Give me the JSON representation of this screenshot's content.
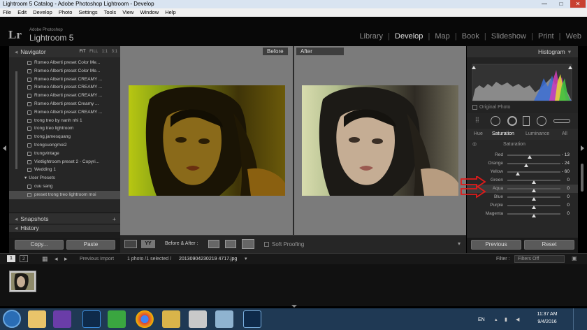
{
  "window": {
    "title": "Lightroom 5 Catalog - Adobe Photoshop Lightroom - Develop",
    "minimize": "—",
    "maximize": "□",
    "close": "✕"
  },
  "menu": [
    "File",
    "Edit",
    "Develop",
    "Photo",
    "Settings",
    "Tools",
    "View",
    "Window",
    "Help"
  ],
  "identity": {
    "logo": "Lr",
    "brand_small": "Adobe Photoshop",
    "brand": "Lightroom 5"
  },
  "modules": {
    "library": "Library",
    "develop": "Develop",
    "map": "Map",
    "book": "Book",
    "slideshow": "Slideshow",
    "print": "Print",
    "web": "Web",
    "sep": "|"
  },
  "left": {
    "navigator": "Navigator",
    "zoom": [
      "FIT",
      "FILL",
      "1:1",
      "3:1"
    ],
    "presets": [
      "Romeo Alberti preset Color Me...",
      "Romeo Alberti preset Color Me...",
      "Romeo Alberti preset CREAMY ...",
      "Romeo Alberti preset CREAMY ...",
      "Romeo Alberti preset CREAMY ...",
      "Romeo Alberti preset Creamy ...",
      "Romeo Alberti preset CREAMY ...",
      "trong treo by nanh nhi 1",
      "trong treo lightroom",
      "trong.jamesquang",
      "trongcuongmoi2",
      "trungvintage",
      "Vietlightroom preset 2 - Copyri...",
      "Wedding 1"
    ],
    "user_presets_label": "User Presets",
    "user_presets": [
      "cuu sang",
      "preset trong treo lightroom moi"
    ],
    "snapshots": "Snapshots",
    "history": "History",
    "plus": "+",
    "copy_btn": "Copy...",
    "paste_btn": "Paste"
  },
  "center": {
    "before_label": "Before",
    "after_label": "After"
  },
  "toolbar": {
    "view_mode": "YY",
    "before_after": "Before & After :",
    "soft_proofing": "Soft Proofing"
  },
  "right": {
    "histogram": "Histogram",
    "original_photo": "Original Photo",
    "tabs": [
      "Hue",
      "Saturation",
      "Luminance",
      "All"
    ],
    "section": "Saturation",
    "sliders": [
      {
        "label": "Red",
        "value": "- 13",
        "pos": 0.42
      },
      {
        "label": "Orange",
        "value": "- 24",
        "pos": 0.36
      },
      {
        "label": "Yellow",
        "value": "- 60",
        "pos": 0.2
      },
      {
        "label": "Green",
        "value": "0",
        "pos": 0.5
      },
      {
        "label": "Aqua",
        "value": "0",
        "pos": 0.5
      },
      {
        "label": "Blue",
        "value": "0",
        "pos": 0.5
      },
      {
        "label": "Purple",
        "value": "0",
        "pos": 0.5
      },
      {
        "label": "Magenta",
        "value": "0",
        "pos": 0.5
      }
    ],
    "previous_btn": "Previous",
    "reset_btn": "Reset"
  },
  "filmstrip": {
    "page1": "1",
    "page2": "2",
    "source": "Previous Import",
    "count": "1 photo /1 selected /",
    "filename": "20130904230219 4717.jpg",
    "filter_label": "Filter :",
    "filter_value": "Filters Off"
  },
  "taskbar": {
    "lang": "EN",
    "time": "11:37 AM",
    "date": "9/4/2016"
  },
  "colors": {
    "annotation_arrow": "#e01b1b",
    "highlight_tab": "#ffffff"
  }
}
